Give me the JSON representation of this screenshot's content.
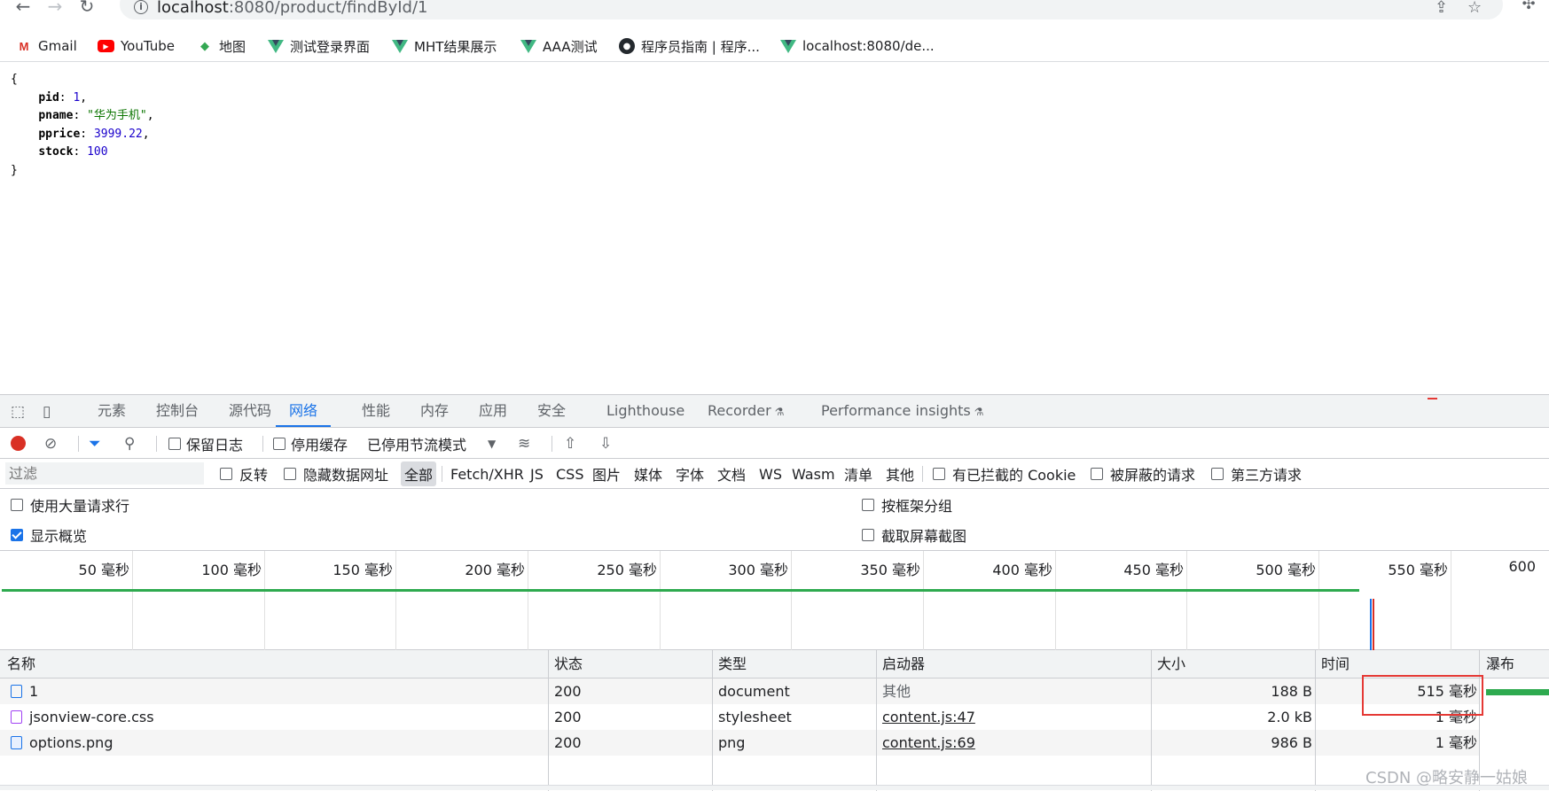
{
  "browser": {
    "url_host": "localhost",
    "url_rest": ":8080/product/findById/1",
    "bookmarks": [
      {
        "label": "Gmail",
        "icon": "gmail-icon",
        "glyph": "M"
      },
      {
        "label": "YouTube",
        "icon": "youtube-icon",
        "glyph": "▶"
      },
      {
        "label": "地图",
        "icon": "maps-icon",
        "glyph": "◆"
      },
      {
        "label": "测试登录界面",
        "icon": "vue-icon",
        "glyph": ""
      },
      {
        "label": "MHT结果展示",
        "icon": "vue-icon",
        "glyph": ""
      },
      {
        "label": "AAA测试",
        "icon": "vue-icon",
        "glyph": ""
      },
      {
        "label": "程序员指南 | 程序...",
        "icon": "github-icon",
        "glyph": "●"
      },
      {
        "label": "localhost:8080/de...",
        "icon": "vue-icon",
        "glyph": ""
      }
    ]
  },
  "json_view": {
    "open": "{",
    "close": "}",
    "fields": [
      {
        "key": "pid",
        "value": "1",
        "type": "number",
        "comma": ","
      },
      {
        "key": "pname",
        "value": "\"华为手机\"",
        "type": "string",
        "comma": ","
      },
      {
        "key": "pprice",
        "value": "3999.22",
        "type": "number",
        "comma": ","
      },
      {
        "key": "stock",
        "value": "100",
        "type": "number",
        "comma": ""
      }
    ]
  },
  "devtools": {
    "tabs": [
      "元素",
      "控制台",
      "源代码",
      "网络",
      "性能",
      "内存",
      "应用",
      "安全",
      "Lighthouse",
      "Recorder",
      "Performance insights"
    ],
    "active_tab": "网络",
    "toolbar": {
      "preserve_log": "保留日志",
      "disable_cache": "停用缓存",
      "throttling": "已停用节流模式"
    },
    "filter": {
      "placeholder": "过滤",
      "invert": "反转",
      "hide_data_urls": "隐藏数据网址",
      "types": [
        "全部",
        "Fetch/XHR",
        "JS",
        "CSS",
        "图片",
        "媒体",
        "字体",
        "文档",
        "WS",
        "Wasm",
        "清单",
        "其他"
      ],
      "blocked_cookies": "有已拦截的 Cookie",
      "blocked_requests": "被屏蔽的请求",
      "third_party": "第三方请求"
    },
    "settings": {
      "big_rows": "使用大量请求行",
      "show_overview": "显示概览",
      "group_by_frame": "按框架分组",
      "screenshots": "截取屏幕截图"
    },
    "overview": {
      "ticks": [
        "50 毫秒",
        "100 毫秒",
        "150 毫秒",
        "200 毫秒",
        "250 毫秒",
        "300 毫秒",
        "350 毫秒",
        "400 毫秒",
        "450 毫秒",
        "500 毫秒",
        "550 毫秒",
        "600"
      ],
      "load_bar_ms": 515
    },
    "table": {
      "headers": [
        "名称",
        "状态",
        "类型",
        "启动器",
        "大小",
        "时间",
        "瀑布"
      ],
      "rows": [
        {
          "name": "1",
          "status": "200",
          "type": "document",
          "initiator": "其他",
          "size": "188 B",
          "time": "515 毫秒"
        },
        {
          "name": "jsonview-core.css",
          "status": "200",
          "type": "stylesheet",
          "initiator": "content.js:47",
          "size": "2.0 kB",
          "time": "1 毫秒"
        },
        {
          "name": "options.png",
          "status": "200",
          "type": "png",
          "initiator": "content.js:69",
          "size": "986 B",
          "time": "1 毫秒"
        }
      ]
    }
  },
  "watermark": "CSDN @略安静一姑娘",
  "colors": {
    "accent": "#1a73e8",
    "record": "#d93025",
    "highlight": "#e53935",
    "bar": "#2eaa4f"
  }
}
